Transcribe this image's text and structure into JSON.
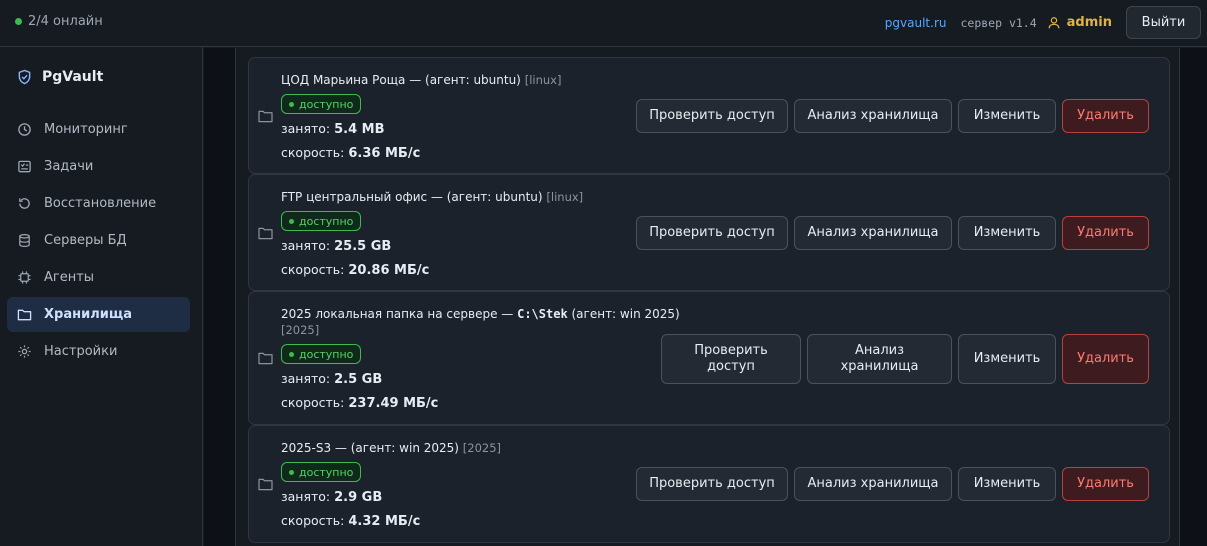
{
  "status": {
    "online_text": "2/4 онлайн"
  },
  "header": {
    "site_link": "pgvault.ru",
    "server_version": "сервер v1.4",
    "user_icon": "user-icon",
    "user_name": "admin",
    "logout_label": "Выйти"
  },
  "sidebar": {
    "brand": "PgVault",
    "items": [
      {
        "label": "Мониторинг",
        "icon": "monitor-icon"
      },
      {
        "label": "Задачи",
        "icon": "tasks-icon"
      },
      {
        "label": "Восстановление",
        "icon": "restore-icon"
      },
      {
        "label": "Серверы БД",
        "icon": "database-icon"
      },
      {
        "label": "Агенты",
        "icon": "chip-icon"
      },
      {
        "label": "Хранилища",
        "icon": "folder-icon",
        "active": true
      },
      {
        "label": "Настройки",
        "icon": "gear-icon"
      }
    ]
  },
  "labels": {
    "used": "занято:",
    "speed": "скорость:",
    "check": "Проверить доступ",
    "analyze": "Анализ хранилища",
    "edit": "Изменить",
    "delete": "Удалить"
  },
  "storages": [
    {
      "name": "ЦОД Марьина Роща — (агент: ubuntu)",
      "tag": "[linux]",
      "status": "доступно",
      "used": "5.4 MB",
      "speed": "6.36 МБ/с"
    },
    {
      "name": "FTP центральный офис — (агент: ubuntu)",
      "tag": "[linux]",
      "status": "доступно",
      "used": "25.5 GB",
      "speed": "20.86 МБ/с"
    },
    {
      "name_prefix": "2025 локальная папка на сервере — ",
      "name_path": "C:\\Stek",
      "name_suffix": " (агент: win 2025)",
      "tag": "[2025]",
      "status": "доступно",
      "used": "2.5 GB",
      "speed": "237.49 МБ/с"
    },
    {
      "name": "2025-S3 — (агент: win 2025)",
      "tag": "[2025]",
      "status": "доступно",
      "used": "2.9 GB",
      "speed": "4.32 МБ/с"
    }
  ]
}
